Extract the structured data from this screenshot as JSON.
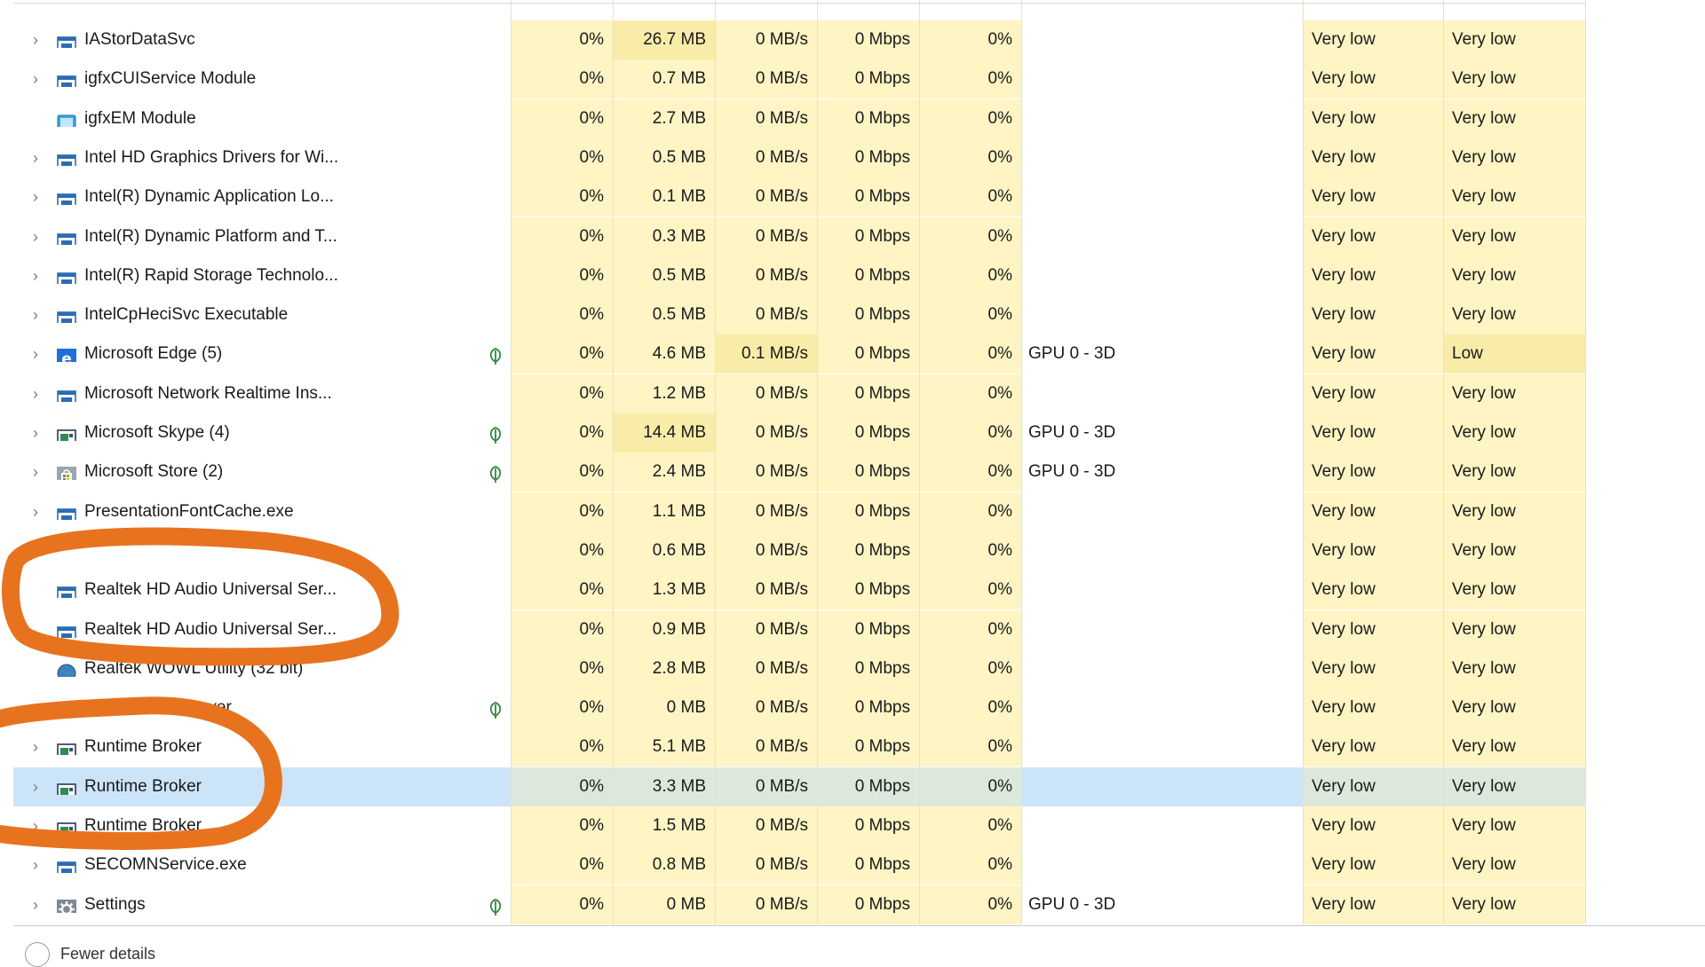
{
  "footer": {
    "fewer_details_label": "Fewer details"
  },
  "colors": {
    "heat_light": "#fff4c4",
    "heat_medium": "#f9eca8",
    "selected_row": "#cce4f7",
    "annotation_orange": "#e8731f",
    "leaf_green": "#2e8b3d",
    "edge_blue": "#1e6fd9"
  },
  "rows": [
    {
      "name": "IAStorDataSvc",
      "icon": "service-window-icon",
      "expandable": true,
      "eco": false,
      "cpu": "0%",
      "memory": "26.7 MB",
      "disk": "0 MB/s",
      "network": "0 Mbps",
      "gpu": "0%",
      "gpu_engine": "",
      "power": "Very low",
      "power_trend": "Very low"
    },
    {
      "name": "igfxCUIService Module",
      "icon": "service-window-icon",
      "expandable": true,
      "eco": false,
      "cpu": "0%",
      "memory": "0.7 MB",
      "disk": "0 MB/s",
      "network": "0 Mbps",
      "gpu": "0%",
      "gpu_engine": "",
      "power": "Very low",
      "power_trend": "Very low"
    },
    {
      "name": "igfxEM Module",
      "icon": "display-app-icon",
      "expandable": false,
      "eco": false,
      "cpu": "0%",
      "memory": "2.7 MB",
      "disk": "0 MB/s",
      "network": "0 Mbps",
      "gpu": "0%",
      "gpu_engine": "",
      "power": "Very low",
      "power_trend": "Very low"
    },
    {
      "name": "Intel HD Graphics Drivers for Wi...",
      "icon": "service-window-icon",
      "expandable": true,
      "eco": false,
      "cpu": "0%",
      "memory": "0.5 MB",
      "disk": "0 MB/s",
      "network": "0 Mbps",
      "gpu": "0%",
      "gpu_engine": "",
      "power": "Very low",
      "power_trend": "Very low"
    },
    {
      "name": "Intel(R) Dynamic Application Lo...",
      "icon": "service-window-icon",
      "expandable": true,
      "eco": false,
      "cpu": "0%",
      "memory": "0.1 MB",
      "disk": "0 MB/s",
      "network": "0 Mbps",
      "gpu": "0%",
      "gpu_engine": "",
      "power": "Very low",
      "power_trend": "Very low"
    },
    {
      "name": "Intel(R) Dynamic Platform and T...",
      "icon": "service-window-icon",
      "expandable": true,
      "eco": false,
      "cpu": "0%",
      "memory": "0.3 MB",
      "disk": "0 MB/s",
      "network": "0 Mbps",
      "gpu": "0%",
      "gpu_engine": "",
      "power": "Very low",
      "power_trend": "Very low"
    },
    {
      "name": "Intel(R) Rapid Storage Technolo...",
      "icon": "service-window-icon",
      "expandable": true,
      "eco": false,
      "cpu": "0%",
      "memory": "0.5 MB",
      "disk": "0 MB/s",
      "network": "0 Mbps",
      "gpu": "0%",
      "gpu_engine": "",
      "power": "Very low",
      "power_trend": "Very low"
    },
    {
      "name": "IntelCpHeciSvc Executable",
      "icon": "service-window-icon",
      "expandable": true,
      "eco": false,
      "cpu": "0%",
      "memory": "0.5 MB",
      "disk": "0 MB/s",
      "network": "0 Mbps",
      "gpu": "0%",
      "gpu_engine": "",
      "power": "Very low",
      "power_trend": "Very low"
    },
    {
      "name": "Microsoft Edge (5)",
      "icon": "edge-icon",
      "expandable": true,
      "eco": true,
      "cpu": "0%",
      "memory": "4.6 MB",
      "disk": "0.1 MB/s",
      "network": "0 Mbps",
      "gpu": "0%",
      "gpu_engine": "GPU 0 - 3D",
      "power": "Very low",
      "power_trend": "Low"
    },
    {
      "name": "Microsoft Network Realtime Ins...",
      "icon": "service-window-icon",
      "expandable": true,
      "eco": false,
      "cpu": "0%",
      "memory": "1.2 MB",
      "disk": "0 MB/s",
      "network": "0 Mbps",
      "gpu": "0%",
      "gpu_engine": "",
      "power": "Very low",
      "power_trend": "Very low"
    },
    {
      "name": "Microsoft Skype (4)",
      "icon": "app-window-icon",
      "expandable": true,
      "eco": true,
      "cpu": "0%",
      "memory": "14.4 MB",
      "disk": "0 MB/s",
      "network": "0 Mbps",
      "gpu": "0%",
      "gpu_engine": "GPU 0 - 3D",
      "power": "Very low",
      "power_trend": "Very low"
    },
    {
      "name": "Microsoft Store (2)",
      "icon": "store-bag-icon",
      "expandable": true,
      "eco": true,
      "cpu": "0%",
      "memory": "2.4 MB",
      "disk": "0 MB/s",
      "network": "0 Mbps",
      "gpu": "0%",
      "gpu_engine": "GPU 0 - 3D",
      "power": "Very low",
      "power_trend": "Very low"
    },
    {
      "name": "PresentationFontCache.exe",
      "icon": "service-window-icon",
      "expandable": true,
      "eco": false,
      "cpu": "0%",
      "memory": "1.1 MB",
      "disk": "0 MB/s",
      "network": "0 Mbps",
      "gpu": "0%",
      "gpu_engine": "",
      "power": "Very low",
      "power_trend": "Very low"
    },
    {
      "name": "",
      "icon": "",
      "expandable": false,
      "eco": false,
      "cpu": "0%",
      "memory": "0.6 MB",
      "disk": "0 MB/s",
      "network": "0 Mbps",
      "gpu": "0%",
      "gpu_engine": "",
      "power": "Very low",
      "power_trend": "Very low"
    },
    {
      "name": "Realtek HD Audio Universal Ser...",
      "icon": "service-window-icon",
      "expandable": false,
      "eco": false,
      "cpu": "0%",
      "memory": "1.3 MB",
      "disk": "0 MB/s",
      "network": "0 Mbps",
      "gpu": "0%",
      "gpu_engine": "",
      "power": "Very low",
      "power_trend": "Very low"
    },
    {
      "name": "Realtek HD Audio Universal Ser...",
      "icon": "service-window-icon",
      "expandable": false,
      "eco": false,
      "cpu": "0%",
      "memory": "0.9 MB",
      "disk": "0 MB/s",
      "network": "0 Mbps",
      "gpu": "0%",
      "gpu_engine": "",
      "power": "Very low",
      "power_trend": "Very low"
    },
    {
      "name": "Realtek WOWL Utility (32 bit)",
      "icon": "globe-icon",
      "expandable": false,
      "eco": false,
      "cpu": "0%",
      "memory": "2.8 MB",
      "disk": "0 MB/s",
      "network": "0 Mbps",
      "gpu": "0%",
      "gpu_engine": "",
      "power": "Very low",
      "power_trend": "Very low"
    },
    {
      "name": "WinRT OOP Server",
      "icon": "app-window-icon",
      "expandable": true,
      "eco": true,
      "cpu": "0%",
      "memory": "0 MB",
      "disk": "0 MB/s",
      "network": "0 Mbps",
      "gpu": "0%",
      "gpu_engine": "",
      "power": "Very low",
      "power_trend": "Very low"
    },
    {
      "name": "Runtime Broker",
      "icon": "app-window-icon",
      "expandable": true,
      "eco": false,
      "cpu": "0%",
      "memory": "5.1 MB",
      "disk": "0 MB/s",
      "network": "0 Mbps",
      "gpu": "0%",
      "gpu_engine": "",
      "power": "Very low",
      "power_trend": "Very low"
    },
    {
      "name": "Runtime Broker",
      "icon": "app-window-icon",
      "expandable": true,
      "eco": false,
      "selected": true,
      "cpu": "0%",
      "memory": "3.3 MB",
      "disk": "0 MB/s",
      "network": "0 Mbps",
      "gpu": "0%",
      "gpu_engine": "",
      "power": "Very low",
      "power_trend": "Very low"
    },
    {
      "name": "Runtime Broker",
      "icon": "app-window-icon",
      "expandable": true,
      "eco": false,
      "cpu": "0%",
      "memory": "1.5 MB",
      "disk": "0 MB/s",
      "network": "0 Mbps",
      "gpu": "0%",
      "gpu_engine": "",
      "power": "Very low",
      "power_trend": "Very low"
    },
    {
      "name": "SECOMNService.exe",
      "icon": "service-window-icon",
      "expandable": true,
      "eco": false,
      "cpu": "0%",
      "memory": "0.8 MB",
      "disk": "0 MB/s",
      "network": "0 Mbps",
      "gpu": "0%",
      "gpu_engine": "",
      "power": "Very low",
      "power_trend": "Very low"
    },
    {
      "name": "Settings",
      "icon": "gear-icon",
      "expandable": true,
      "eco": true,
      "cpu": "0%",
      "memory": "0 MB",
      "disk": "0 MB/s",
      "network": "0 Mbps",
      "gpu": "0%",
      "gpu_engine": "GPU 0 - 3D",
      "power": "Very low",
      "power_trend": "Very low"
    }
  ]
}
